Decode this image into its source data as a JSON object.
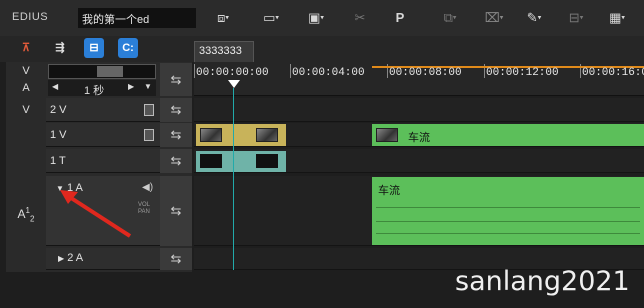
{
  "app": {
    "name": "EDIUS",
    "project": "我的第一个ed"
  },
  "toolbar": {
    "items": [
      {
        "name": "sequence-icon",
        "glyph": "⬚"
      },
      {
        "name": "folder-icon",
        "glyph": "📁"
      },
      {
        "name": "save-icon",
        "glyph": "💾"
      },
      {
        "name": "cut-icon",
        "glyph": "✂"
      },
      {
        "name": "p-icon",
        "glyph": "P"
      },
      {
        "name": "copy-icon",
        "glyph": "⧉"
      },
      {
        "name": "delete-icon",
        "glyph": "⌧"
      },
      {
        "name": "pen-icon",
        "glyph": "✎"
      },
      {
        "name": "snap-icon",
        "glyph": "⊟"
      }
    ]
  },
  "tab": {
    "label": "3333333"
  },
  "ruler": {
    "timecodes": [
      "00:00:00:00",
      "00:00:04:00",
      "00:00:08:00",
      "00:00:12:00",
      "00:00:16:00"
    ]
  },
  "header": {
    "v_label": "V",
    "a_label": "A",
    "scale": "1 秒"
  },
  "tracks": [
    {
      "type": "V",
      "name": "2 V"
    },
    {
      "type": "",
      "name": "1 V"
    },
    {
      "type": "",
      "name": "1 T"
    },
    {
      "type": "A",
      "name": "1 A"
    },
    {
      "type": "",
      "name": "2 A"
    }
  ],
  "vol_pan": "VOL PAN",
  "clips": {
    "video_label": "车流",
    "audio_label": "车流"
  },
  "watermark": "sanlang2021",
  "colors": {
    "clip_green": "#5cbf5a",
    "ruler_accent": "#e08a1a",
    "arrow": "#e0281e"
  }
}
